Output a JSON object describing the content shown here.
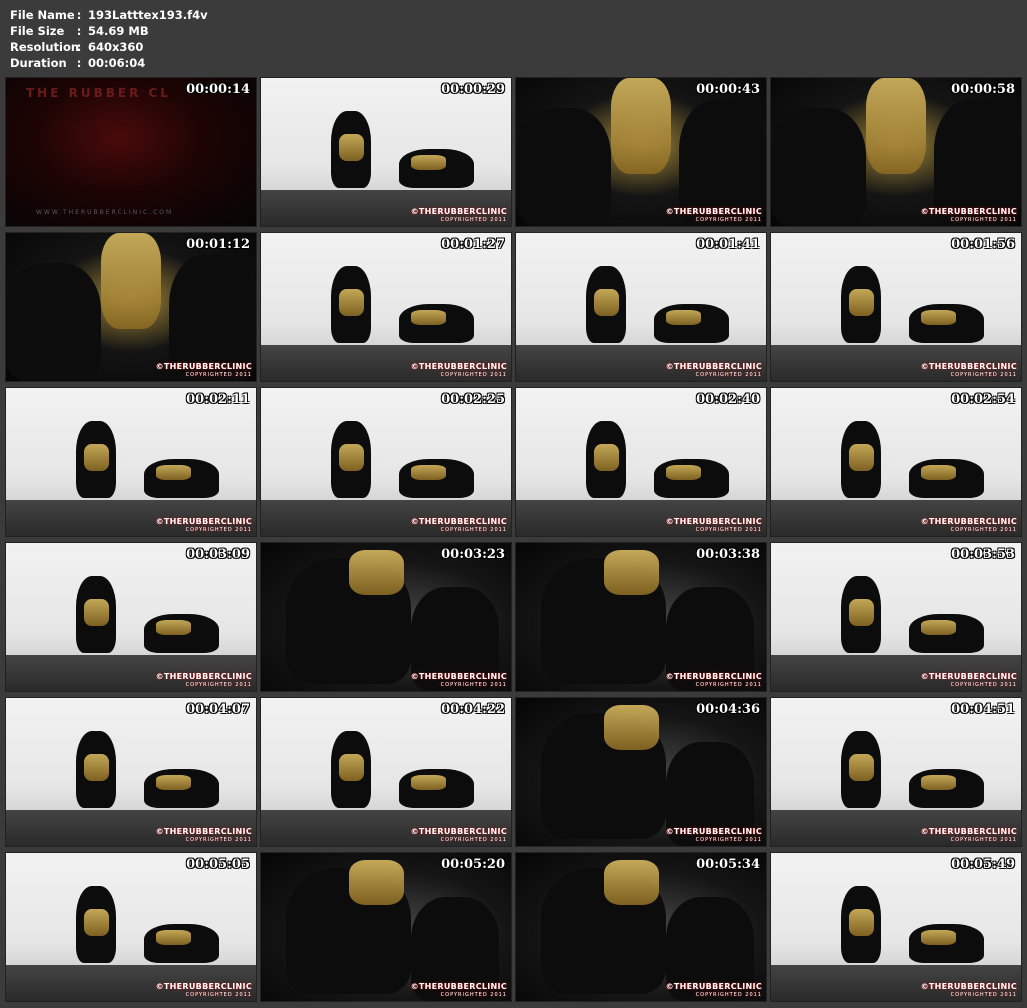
{
  "file_info": {
    "rows": [
      {
        "key": "File Name",
        "sep": ":",
        "value": "193Latttex193.f4v"
      },
      {
        "key": "File Size",
        "sep": ":",
        "value": "54.69 MB"
      },
      {
        "key": "Resolution",
        "sep": ":",
        "value": "640x360"
      },
      {
        "key": "Duration",
        "sep": ":",
        "value": "00:06:04"
      }
    ]
  },
  "watermark": {
    "brand": "©THERUBBERCLINIC",
    "copyright": "COPYRIGHTED 2011"
  },
  "intro": {
    "title": "THE RUBBER CL",
    "url": "WWW.THERUBBERCLINIC.COM"
  },
  "thumbnails": [
    {
      "time": "00:00:14",
      "scene": "intro"
    },
    {
      "time": "00:00:29",
      "scene": "wall"
    },
    {
      "time": "00:00:43",
      "scene": "close"
    },
    {
      "time": "00:00:58",
      "scene": "close"
    },
    {
      "time": "00:01:12",
      "scene": "close"
    },
    {
      "time": "00:01:27",
      "scene": "wall"
    },
    {
      "time": "00:01:41",
      "scene": "wall"
    },
    {
      "time": "00:01:56",
      "scene": "wall"
    },
    {
      "time": "00:02:11",
      "scene": "wall"
    },
    {
      "time": "00:02:25",
      "scene": "wall"
    },
    {
      "time": "00:02:40",
      "scene": "wall"
    },
    {
      "time": "00:02:54",
      "scene": "wall"
    },
    {
      "time": "00:03:09",
      "scene": "wall"
    },
    {
      "time": "00:03:23",
      "scene": "dark"
    },
    {
      "time": "00:03:38",
      "scene": "dark"
    },
    {
      "time": "00:03:53",
      "scene": "wall"
    },
    {
      "time": "00:04:07",
      "scene": "wall"
    },
    {
      "time": "00:04:22",
      "scene": "wall"
    },
    {
      "time": "00:04:36",
      "scene": "dark"
    },
    {
      "time": "00:04:51",
      "scene": "wall"
    },
    {
      "time": "00:05:05",
      "scene": "wall"
    },
    {
      "time": "00:05:20",
      "scene": "dark"
    },
    {
      "time": "00:05:34",
      "scene": "dark"
    },
    {
      "time": "00:05:49",
      "scene": "wall"
    }
  ]
}
